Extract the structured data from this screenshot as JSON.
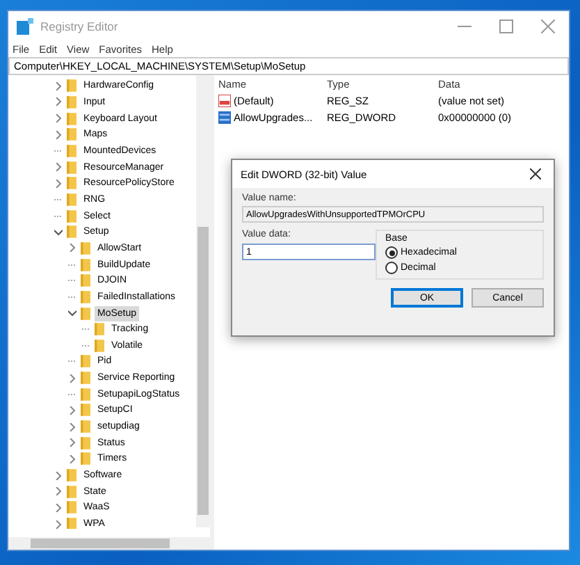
{
  "window": {
    "title": "Registry Editor",
    "active": false
  },
  "menu": [
    "File",
    "Edit",
    "View",
    "Favorites",
    "Help"
  ],
  "address": "Computer\\HKEY_LOCAL_MACHINE\\SYSTEM\\Setup\\MoSetup",
  "tree": {
    "items": [
      {
        "label": "HardwareConfig",
        "kind": "branch",
        "expanded": false,
        "selected": false
      },
      {
        "label": "Input",
        "kind": "branch",
        "expanded": false,
        "selected": false
      },
      {
        "label": "Keyboard Layout",
        "kind": "branch",
        "expanded": false,
        "selected": false
      },
      {
        "label": "Maps",
        "kind": "branch",
        "expanded": false,
        "selected": false
      },
      {
        "label": "MountedDevices",
        "kind": "leaf",
        "selected": false
      },
      {
        "label": "ResourceManager",
        "kind": "branch",
        "expanded": false,
        "selected": false
      },
      {
        "label": "ResourcePolicyStore",
        "kind": "branch",
        "expanded": false,
        "selected": false
      },
      {
        "label": "RNG",
        "kind": "leaf",
        "selected": false
      },
      {
        "label": "Select",
        "kind": "leaf",
        "selected": false
      },
      {
        "label": "Setup",
        "kind": "branch",
        "expanded": true,
        "selected": false,
        "children": [
          {
            "label": "AllowStart",
            "kind": "branch",
            "expanded": false,
            "selected": false
          },
          {
            "label": "BuildUpdate",
            "kind": "leaf",
            "selected": false
          },
          {
            "label": "DJOIN",
            "kind": "leaf",
            "selected": false
          },
          {
            "label": "FailedInstallations",
            "kind": "leaf",
            "selected": false
          },
          {
            "label": "MoSetup",
            "kind": "branch",
            "expanded": true,
            "selected": true,
            "children": [
              {
                "label": "Tracking",
                "kind": "leaf",
                "selected": false
              },
              {
                "label": "Volatile",
                "kind": "leaf",
                "selected": false
              }
            ]
          },
          {
            "label": "Pid",
            "kind": "leaf",
            "selected": false
          },
          {
            "label": "Service Reporting",
            "kind": "branch",
            "expanded": false,
            "selected": false
          },
          {
            "label": "SetupapiLogStatus",
            "kind": "leaf",
            "selected": false
          },
          {
            "label": "SetupCI",
            "kind": "branch",
            "expanded": false,
            "selected": false
          },
          {
            "label": "setupdiag",
            "kind": "branch",
            "expanded": false,
            "selected": false
          },
          {
            "label": "Status",
            "kind": "branch",
            "expanded": false,
            "selected": false
          },
          {
            "label": "Timers",
            "kind": "branch",
            "expanded": false,
            "selected": false
          }
        ]
      },
      {
        "label": "Software",
        "kind": "branch",
        "expanded": false,
        "selected": false
      },
      {
        "label": "State",
        "kind": "branch",
        "expanded": false,
        "selected": false
      },
      {
        "label": "WaaS",
        "kind": "branch",
        "expanded": false,
        "selected": false
      },
      {
        "label": "WPA",
        "kind": "branch",
        "expanded": false,
        "selected": false
      }
    ]
  },
  "values": {
    "columns": [
      "Name",
      "Type",
      "Data"
    ],
    "rows": [
      {
        "kind": "string",
        "name": "(Default)",
        "type": "REG_SZ",
        "data": "(value not set)"
      },
      {
        "kind": "binary",
        "name": "AllowUpgrades...",
        "type": "REG_DWORD",
        "data": "0x00000000 (0)"
      }
    ]
  },
  "dialog": {
    "title": "Edit DWORD (32-bit) Value",
    "name_label": "Value name:",
    "name_value": "AllowUpgradesWithUnsupportedTPMOrCPU",
    "data_label": "Value data:",
    "data_value": "1",
    "base_label": "Base",
    "bases": [
      {
        "label": "Hexadecimal",
        "selected": true
      },
      {
        "label": "Decimal",
        "selected": false
      }
    ],
    "buttons": [
      {
        "label": "OK",
        "default": true
      },
      {
        "label": "Cancel",
        "default": false
      }
    ]
  }
}
